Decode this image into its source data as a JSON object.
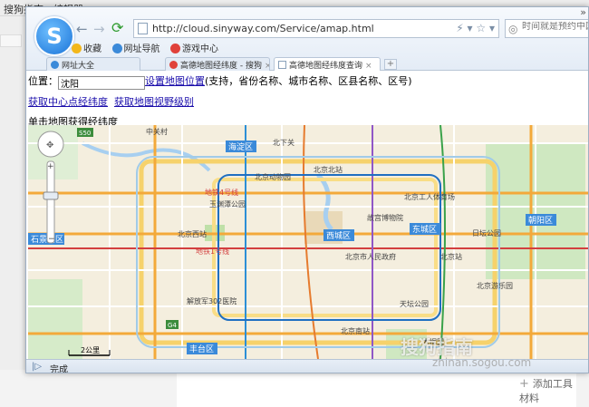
{
  "background": {
    "title": "搜狗指南 - 编辑器",
    "add_material": "添加工具材料"
  },
  "browser": {
    "url": "http://cloud.sinyway.com/Service/amap.html",
    "search_placeholder": "时间就是预约中国",
    "bookmarks": [
      "收藏",
      "网址导航",
      "游戏中心"
    ],
    "tabs": [
      {
        "label": "网址大全"
      },
      {
        "label": "高德地图经纬度 - 搜狗"
      },
      {
        "label": "高德地图经纬度查询"
      }
    ],
    "status": "完成"
  },
  "page": {
    "position_label": "位置：",
    "position_value": "沈阳",
    "set_position_link": "设置地图位置",
    "hint": "(支持，省份名称、城市名称、区县名称、区号)",
    "get_center_link": "获取中心点经纬度",
    "get_zoom_link": "获取地图视野级别",
    "click_hint": "单击地图获得经纬度"
  },
  "map": {
    "districts": [
      "海淀区",
      "西城区",
      "东城区",
      "朝阳区",
      "丰台区",
      "石景山区"
    ],
    "labels": [
      "北京动物园",
      "北京北站",
      "故宫博物院",
      "北京西站",
      "北京站",
      "北京南站",
      "中关村",
      "北下关",
      "北京工人体育场",
      "日坛公园",
      "北京市人民政府",
      "解放军302医院",
      "北京游乐园",
      "玉渊潭公园",
      "天坛公园",
      "木樨园",
      "大红门",
      "广安门",
      "陶然亭",
      "北京大学",
      "国子监",
      "团结湖",
      "亮马桥",
      "建国门",
      "朝阳门",
      "东直门",
      "西直门",
      "公主坟",
      "五棵松",
      "丰台站",
      "马连道",
      "白纸坊",
      "右安门",
      "永定门",
      "潘家园",
      "劲松",
      "双井",
      "四惠",
      "小红门",
      "左安门",
      "北京西客站",
      "中关村软件园"
    ],
    "scale_label": "2公里",
    "road_labels": [
      "地铁4号线",
      "地铁1号线"
    ],
    "highway_shields": [
      "S50",
      "G4",
      "G6"
    ]
  },
  "watermark": {
    "brand": "搜狗指南",
    "url": "zhinan.sogou.com"
  }
}
